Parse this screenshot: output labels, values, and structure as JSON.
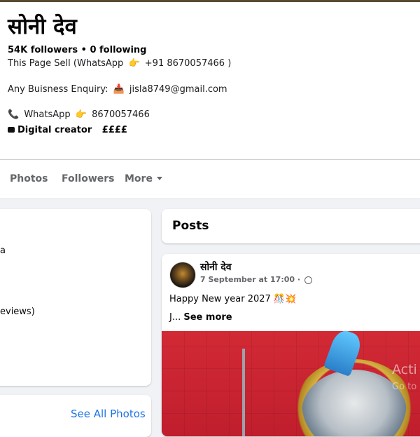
{
  "profile": {
    "name": "सोनी देव",
    "stats": "54K followers • 0 following",
    "bio_line1_prefix": "This Page Sell (WhatsApp",
    "bio_line1_suffix": "+91 8670057466 )",
    "bio_line2_prefix": "Any Buisness Enquiry:",
    "bio_line2_email": "jisla8749@gmail.com",
    "bio_line3_label": "WhatsApp",
    "bio_line3_number": "8670057466",
    "category": "Digital creator",
    "price_level": "££££"
  },
  "icons": {
    "pointing_hand": "👉",
    "inbox": "📥",
    "phone": "📞"
  },
  "tabs": [
    {
      "label": "Photos"
    },
    {
      "label": "Followers"
    },
    {
      "label": "More"
    }
  ],
  "left": {
    "fragment1": "a",
    "fragment2": "eviews)",
    "see_all_photos": "See All Photos"
  },
  "posts": {
    "title": "Posts",
    "post": {
      "author": "सोनी देव",
      "time": "7 September at 17:00 ·",
      "text": "Happy New year 2027 🎊💥",
      "truncated": "J...",
      "see_more": "See more",
      "watermark_line1": "Acti",
      "watermark_line2": "Go to"
    }
  },
  "colors": {
    "link_blue": "#1b74e4",
    "page_bg": "#f0f2f5",
    "photo_red": "#c01e2d"
  }
}
